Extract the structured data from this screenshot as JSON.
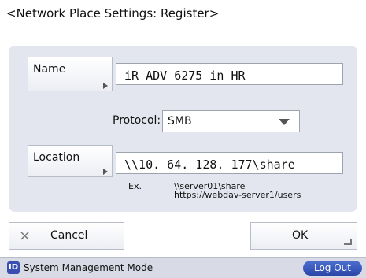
{
  "window": {
    "title": "<Network Place Settings: Register>"
  },
  "form": {
    "name_button": "Name",
    "name_value": "iR ADV 6275 in HR",
    "protocol_label": "Protocol:",
    "protocol_value": "SMB",
    "location_button": "Location",
    "location_value": "\\\\10. 64. 128. 177\\share",
    "example_label": "Ex.",
    "example_line1": "\\\\server01\\share",
    "example_line2": "https://webdav-server1/users"
  },
  "actions": {
    "cancel_icon": "×",
    "cancel_label": "Cancel",
    "ok_label": "OK"
  },
  "status_bar": {
    "id_icon_text": "ID",
    "mode_text": "System Management Mode",
    "logout_label": "Log Out"
  },
  "colors": {
    "panel": "#e3e6ef",
    "status_bar": "#d8dbe5",
    "logout_button": "#2a47a8"
  }
}
